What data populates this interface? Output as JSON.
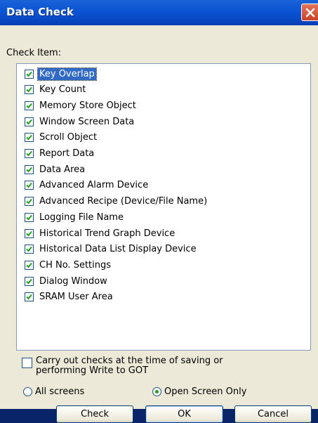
{
  "window": {
    "title": "Data Check",
    "close_icon": "close-icon"
  },
  "check_item_label": "Check Item:",
  "items": [
    {
      "label": "Key Overlap",
      "checked": true,
      "selected": true
    },
    {
      "label": "Key Count",
      "checked": true
    },
    {
      "label": "Memory Store Object",
      "checked": true
    },
    {
      "label": "Window Screen Data",
      "checked": true
    },
    {
      "label": "Scroll Object",
      "checked": true
    },
    {
      "label": "Report Data",
      "checked": true
    },
    {
      "label": "Data Area",
      "checked": true
    },
    {
      "label": "Advanced Alarm Device",
      "checked": true
    },
    {
      "label": "Advanced Recipe (Device/File Name)",
      "checked": true
    },
    {
      "label": "Logging File Name",
      "checked": true
    },
    {
      "label": "Historical Trend Graph Device",
      "checked": true
    },
    {
      "label": "Historical Data List Display Device",
      "checked": true
    },
    {
      "label": "CH No. Settings",
      "checked": true
    },
    {
      "label": "Dialog Window",
      "checked": true
    },
    {
      "label": "SRAM User Area",
      "checked": true
    }
  ],
  "save_option": {
    "line1": "Carry out checks at the time of saving or",
    "line2": "performing Write to GOT",
    "checked": false
  },
  "scope": {
    "all_screens": "All screens",
    "open_screen_only": "Open Screen Only",
    "selected": "open_screen_only"
  },
  "buttons": {
    "check": "Check",
    "ok": "OK",
    "cancel": "Cancel"
  },
  "colors": {
    "titlebar": "#0a54d6",
    "dialog_bg": "#ece9d8",
    "check_mark": "#21a121",
    "selection": "#316ac5"
  }
}
